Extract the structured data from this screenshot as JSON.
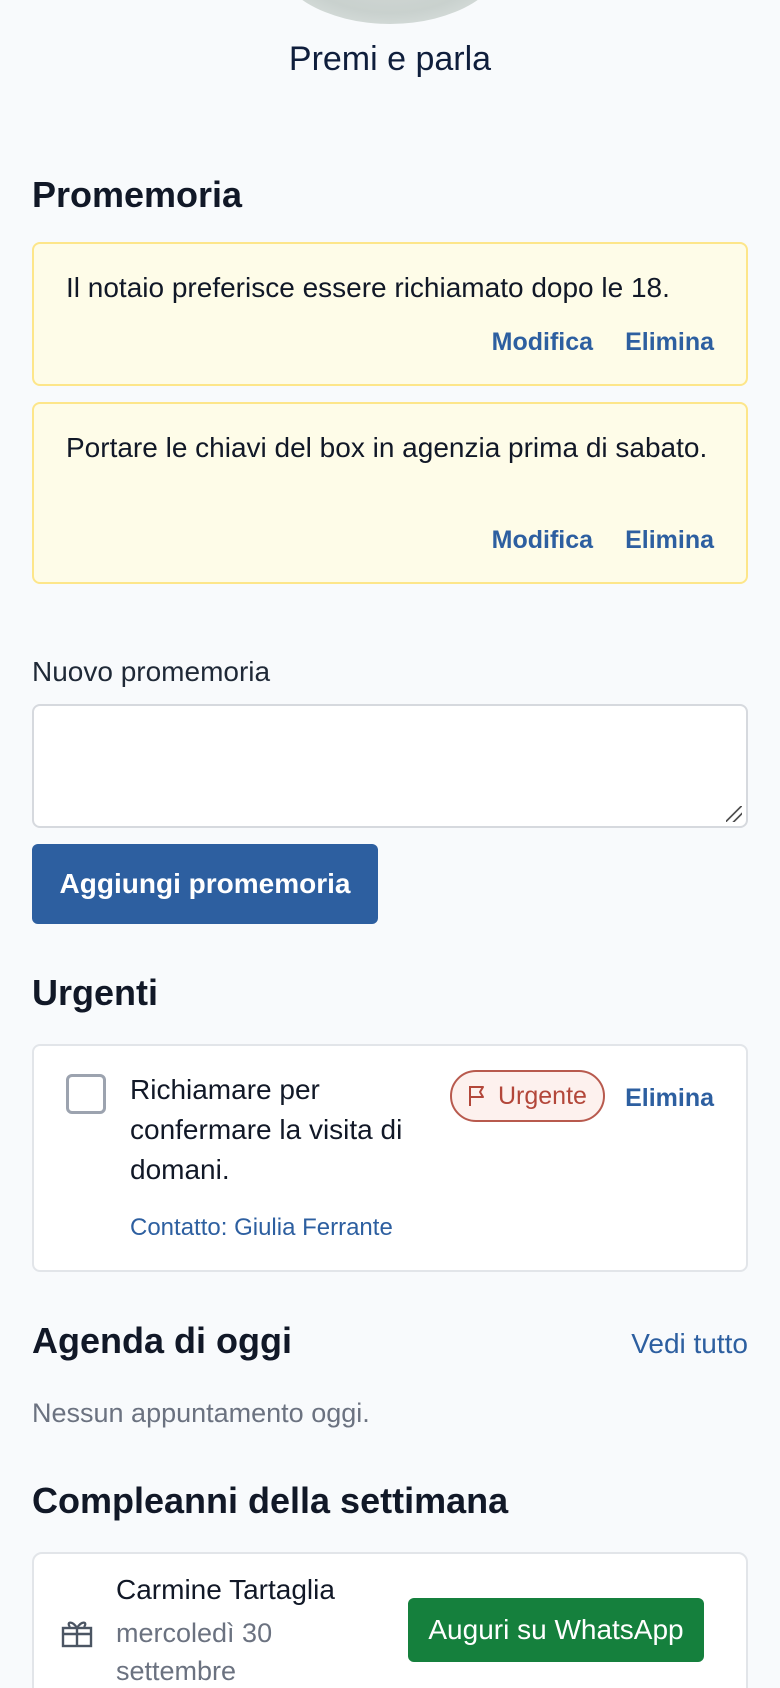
{
  "hero": {
    "label": "Premi e parla"
  },
  "reminders": {
    "title": "Promemoria",
    "items": [
      {
        "text": "Il notaio preferisce essere richiamato dopo le 18.",
        "edit": "Modifica",
        "delete": "Elimina"
      },
      {
        "text": "Portare le chiavi del box in agenzia prima di sabato.",
        "edit": "Modifica",
        "delete": "Elimina"
      }
    ],
    "new_label": "Nuovo promemoria",
    "new_value": "",
    "add_button": "Aggiungi promemoria"
  },
  "urgent": {
    "title": "Urgenti",
    "items": [
      {
        "text": "Richiamare per confermare la visita di domani.",
        "contact": "Contatto: Giulia Ferrante",
        "badge": "Urgente",
        "delete": "Elimina",
        "checked": false
      }
    ]
  },
  "agenda": {
    "title": "Agenda di oggi",
    "see_all": "Vedi tutto",
    "empty": "Nessun appuntamento oggi."
  },
  "birthdays": {
    "title": "Compleanni della settimana",
    "items": [
      {
        "name": "Carmine Tartaglia",
        "date": "mercoledì 30 settembre",
        "action": "Auguri su WhatsApp"
      }
    ]
  },
  "colors": {
    "accent": "#2d5fa0",
    "whatsapp": "#15803d",
    "note_bg": "#fefce8",
    "urgent": "#b3473a"
  },
  "icons": {
    "urgent_badge": "flag-icon",
    "birthday": "gift-icon"
  }
}
